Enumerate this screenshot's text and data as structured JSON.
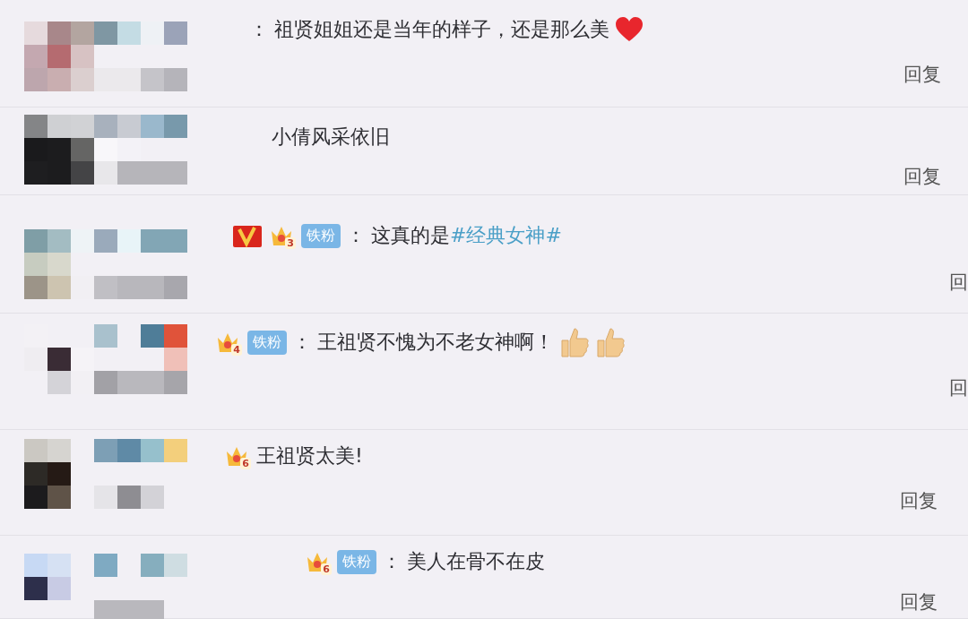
{
  "comments": [
    {
      "colon": "：",
      "parts": [
        {
          "kind": "text",
          "text": "祖贤姐姐还是当年的样子，还是那么美"
        }
      ],
      "emojis": [
        {
          "kind": "heart"
        }
      ],
      "reply": "回复"
    },
    {
      "parts": [
        {
          "kind": "text",
          "text": "小倩风采依旧"
        }
      ],
      "reply": "回复"
    },
    {
      "badges": [
        {
          "kind": "verified"
        },
        {
          "kind": "level",
          "label": "3"
        },
        {
          "kind": "fan",
          "label": "铁粉"
        }
      ],
      "colon": "：",
      "parts": [
        {
          "kind": "text",
          "text": "这真的是"
        },
        {
          "kind": "hashtag",
          "text": "#经典女神#"
        }
      ],
      "reply": "回"
    },
    {
      "badges": [
        {
          "kind": "level",
          "label": "4"
        },
        {
          "kind": "fan",
          "label": "铁粉"
        }
      ],
      "colon": "：",
      "parts": [
        {
          "kind": "text",
          "text": "王祖贤不愧为不老女神啊！"
        }
      ],
      "emojis": [
        {
          "kind": "thumbs-up"
        },
        {
          "kind": "thumbs-up"
        }
      ],
      "reply": "回"
    },
    {
      "badges": [
        {
          "kind": "level",
          "label": "6"
        }
      ],
      "parts": [
        {
          "kind": "text",
          "text": "王祖贤太美!"
        }
      ],
      "reply": "回复"
    },
    {
      "badges": [
        {
          "kind": "level",
          "label": "6"
        },
        {
          "kind": "fan",
          "label": "铁粉"
        }
      ],
      "colon": "：",
      "parts": [
        {
          "kind": "text",
          "text": "美人在骨不在皮"
        }
      ],
      "reply": "回复"
    }
  ]
}
